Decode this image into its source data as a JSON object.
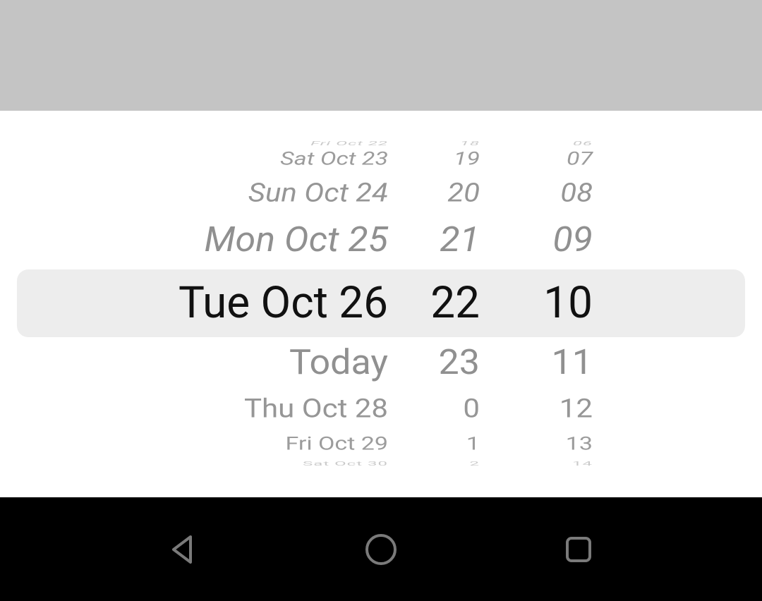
{
  "picker": {
    "date_column": [
      "Fri Oct 22",
      "Sat Oct 23",
      "Sun Oct 24",
      "Mon Oct 25",
      "Tue Oct 26",
      "Today",
      "Thu Oct 28",
      "Fri Oct 29",
      "Sat Oct 30"
    ],
    "hour_column": [
      "18",
      "19",
      "20",
      "21",
      "22",
      "23",
      "0",
      "1",
      "2"
    ],
    "minute_column": [
      "06",
      "07",
      "08",
      "09",
      "10",
      "11",
      "12",
      "13",
      "14"
    ],
    "selected": {
      "date": "Tue Oct 26",
      "hour": "22",
      "minute": "10"
    }
  },
  "navbar": {
    "back": "Back",
    "home": "Home",
    "recent": "Recent apps"
  }
}
